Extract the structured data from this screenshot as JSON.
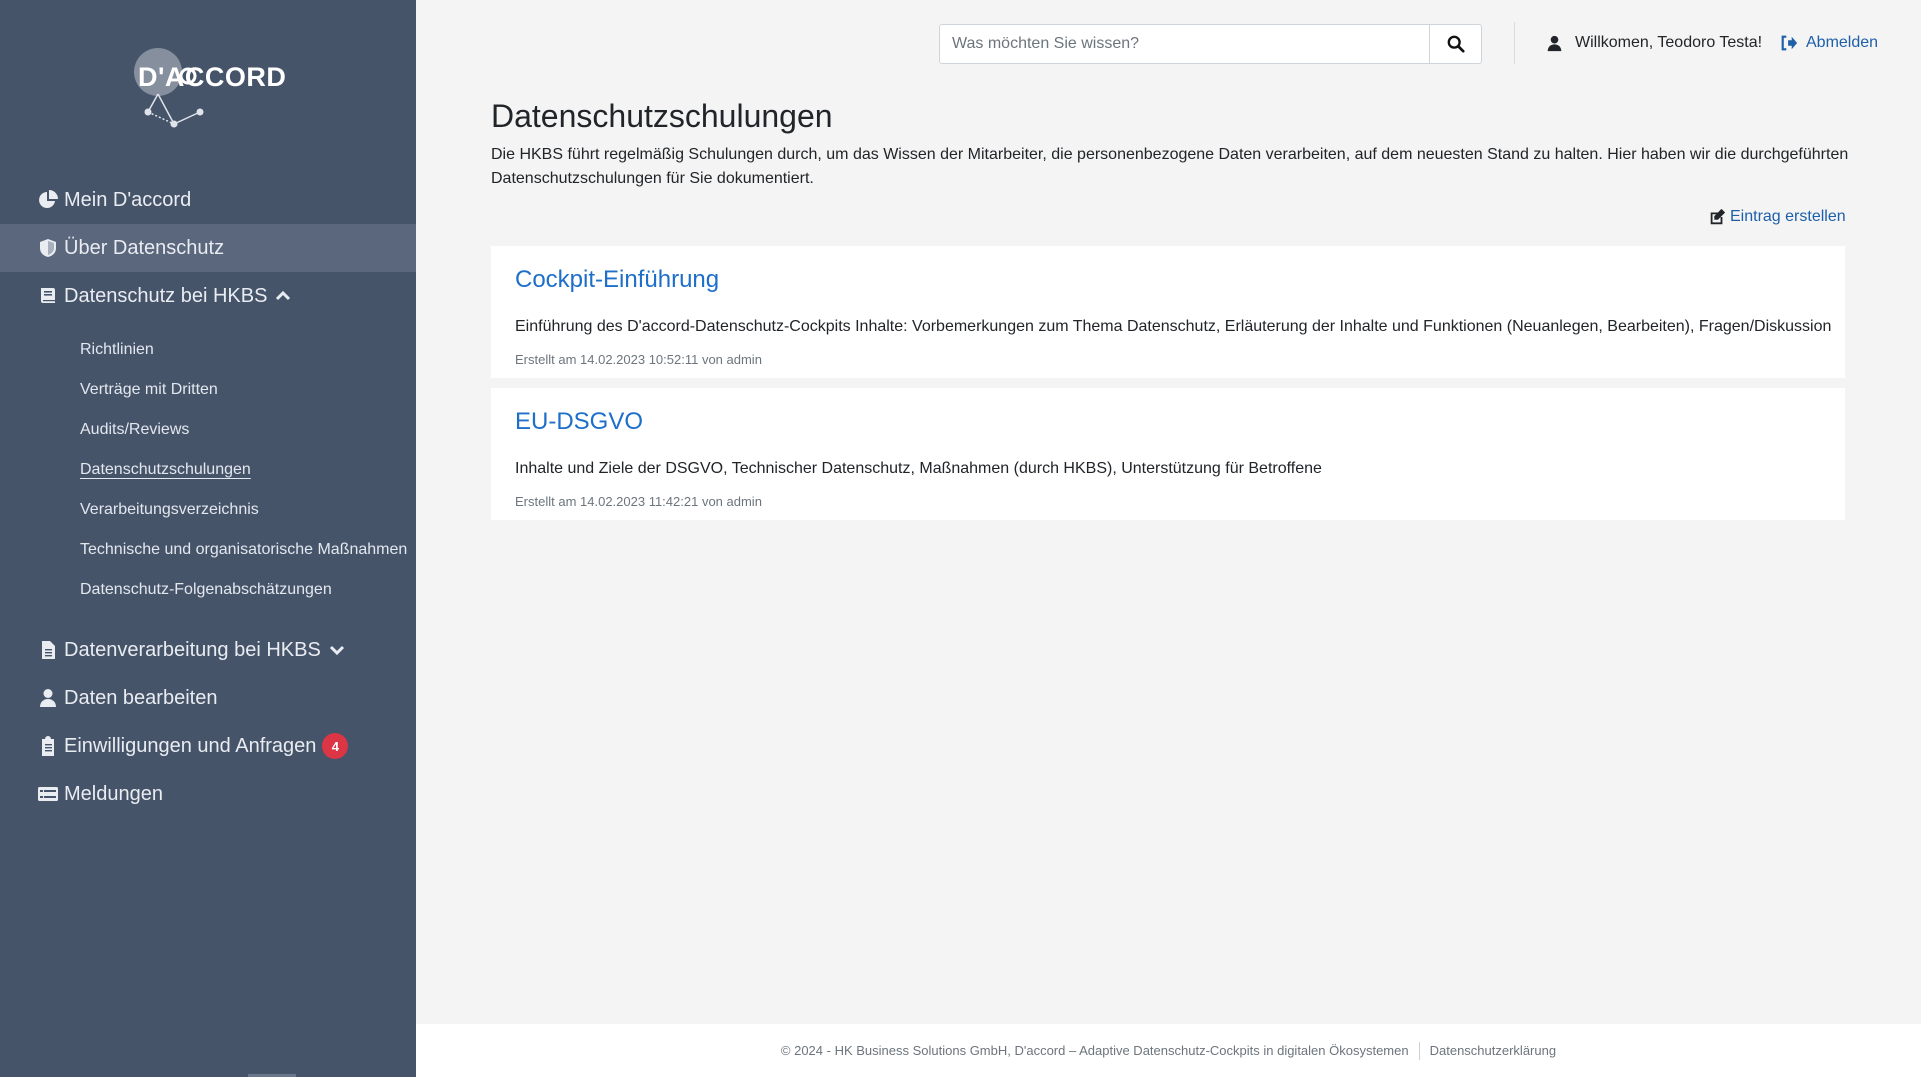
{
  "brand": {
    "logo_text": "D'ACCORD"
  },
  "sidebar": {
    "items": [
      {
        "label": "Mein D'accord",
        "icon": "pie-chart-icon"
      },
      {
        "label": "Über Datenschutz",
        "icon": "shield-icon",
        "active": true
      },
      {
        "label": "Datenschutz bei HKBS",
        "icon": "book-icon",
        "expanded": true
      }
    ],
    "subitems": [
      "Richtlinien",
      "Verträge mit Dritten",
      "Audits/Reviews",
      "Datenschutzschulungen",
      "Verarbeitungsverzeichnis",
      "Technische und organisatorische Maßnahmen",
      "Datenschutz-Folgenabschätzungen"
    ],
    "items_after": [
      {
        "label": "Datenverarbeitung bei HKBS",
        "icon": "file-icon"
      },
      {
        "label": "Daten bearbeiten",
        "icon": "user-icon"
      },
      {
        "label": "Einwilligungen und Anfragen",
        "icon": "clipboard-icon",
        "badge": "4"
      },
      {
        "label": "Meldungen",
        "icon": "list-icon"
      }
    ]
  },
  "header": {
    "search_placeholder": "Was möchten Sie wissen?",
    "welcome": "Willkomen, Teodoro Testa!",
    "logout": "Abmelden"
  },
  "main": {
    "title": "Datenschutzschulungen",
    "intro": "Die HKBS führt regelmäßig Schulungen durch, um das Wissen der Mitarbeiter, die personenbezogene Daten verarbeiten, auf dem neuesten Stand zu halten. Hier haben wir die durchgeführten Datenschutzschulungen für Sie dokumentiert.",
    "create_label": "Eintrag erstellen",
    "entries": [
      {
        "title": "Cockpit-Einführung",
        "body": "Einführung des D'accord-Datenschutz-Cockpits Inhalte: Vorbemerkungen zum Thema Datenschutz, Erläuterung der Inhalte und Funktionen (Neuanlegen, Bearbeiten), Fragen/Diskussion",
        "meta": "Erstellt am 14.02.2023 10:52:11 von admin"
      },
      {
        "title": "EU-DSGVO",
        "body": "Inhalte und Ziele der DSGVO, Technischer Datenschutz, Maßnahmen (durch HKBS), Unterstützung für Betroffene",
        "meta": "Erstellt am 14.02.2023 11:42:21 von admin"
      }
    ]
  },
  "footer": {
    "copyright": "© 2024 - HK Business Solutions GmbH, D'accord – Adaptive Datenschutz-Cockpits in digitalen Ökosystemen",
    "privacy": "Datenschutzerklärung"
  },
  "colors": {
    "sidebar": "#46546a",
    "sidebar_active": "#5a677c",
    "link": "#1d6fc9",
    "badge": "#dc3545"
  }
}
